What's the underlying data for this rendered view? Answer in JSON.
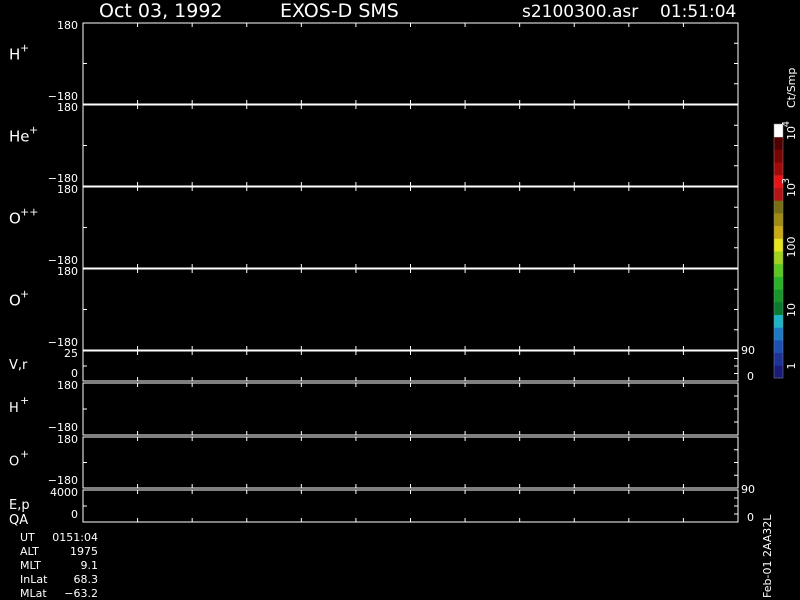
{
  "header": {
    "date": "Oct 03, 1992",
    "instrument": "EXOS-D SMS",
    "file": "s2100300.asr",
    "time": "01:51:04"
  },
  "chart_data": {
    "type": "heatmap",
    "x_tick_count": 13,
    "panels": [
      {
        "label": "H",
        "sup": "+",
        "ymax": "180",
        "ymin": "−180"
      },
      {
        "label": "He",
        "sup": "+",
        "ymax": "180",
        "ymin": "−180"
      },
      {
        "label": "O",
        "sup": "++",
        "ymax": "180",
        "ymin": "−180"
      },
      {
        "label": "O",
        "sup": "+",
        "ymax": "180",
        "ymin": "−180"
      },
      {
        "label": "V,r",
        "sup": "",
        "ymax": "25",
        "ymin": "0",
        "rmax": "90",
        "rmin": "0"
      },
      {
        "label": "H",
        "sup": "+",
        "ymax": "180",
        "ymin": "−180"
      },
      {
        "label": "O",
        "sup": "+",
        "ymax": "180",
        "ymin": "−180"
      },
      {
        "label": "E,p",
        "label2": "QA",
        "sup": "",
        "ymax": "4000",
        "ymin": "0",
        "rmax": "90",
        "rmin": "0"
      }
    ],
    "colorbar": {
      "unit": "Ct/Smp",
      "tick_labels": [
        "1",
        "10",
        "100",
        "10",
        "10"
      ],
      "tick_sups": [
        "",
        "",
        "",
        "3",
        "4"
      ],
      "colors": [
        "#1a1a78",
        "#1f3296",
        "#1e4fb4",
        "#1e78c8",
        "#1eb4c8",
        "#0a7a32",
        "#169628",
        "#28b428",
        "#5ac81e",
        "#a0d21e",
        "#e6e61e",
        "#c8aa14",
        "#a08c14",
        "#786e14",
        "#b41414",
        "#e61414",
        "#a00a0a",
        "#780505",
        "#500000",
        "#ffffff"
      ]
    },
    "footer": {
      "rows": [
        {
          "label": "UT",
          "value": "0151:04"
        },
        {
          "label": "ALT",
          "value": "1975"
        },
        {
          "label": "MLT",
          "value": "9.1"
        },
        {
          "label": "InLat",
          "value": "68.3"
        },
        {
          "label": "MLat",
          "value": "−63.2"
        }
      ],
      "version": "Feb-01 2AA32L"
    }
  }
}
